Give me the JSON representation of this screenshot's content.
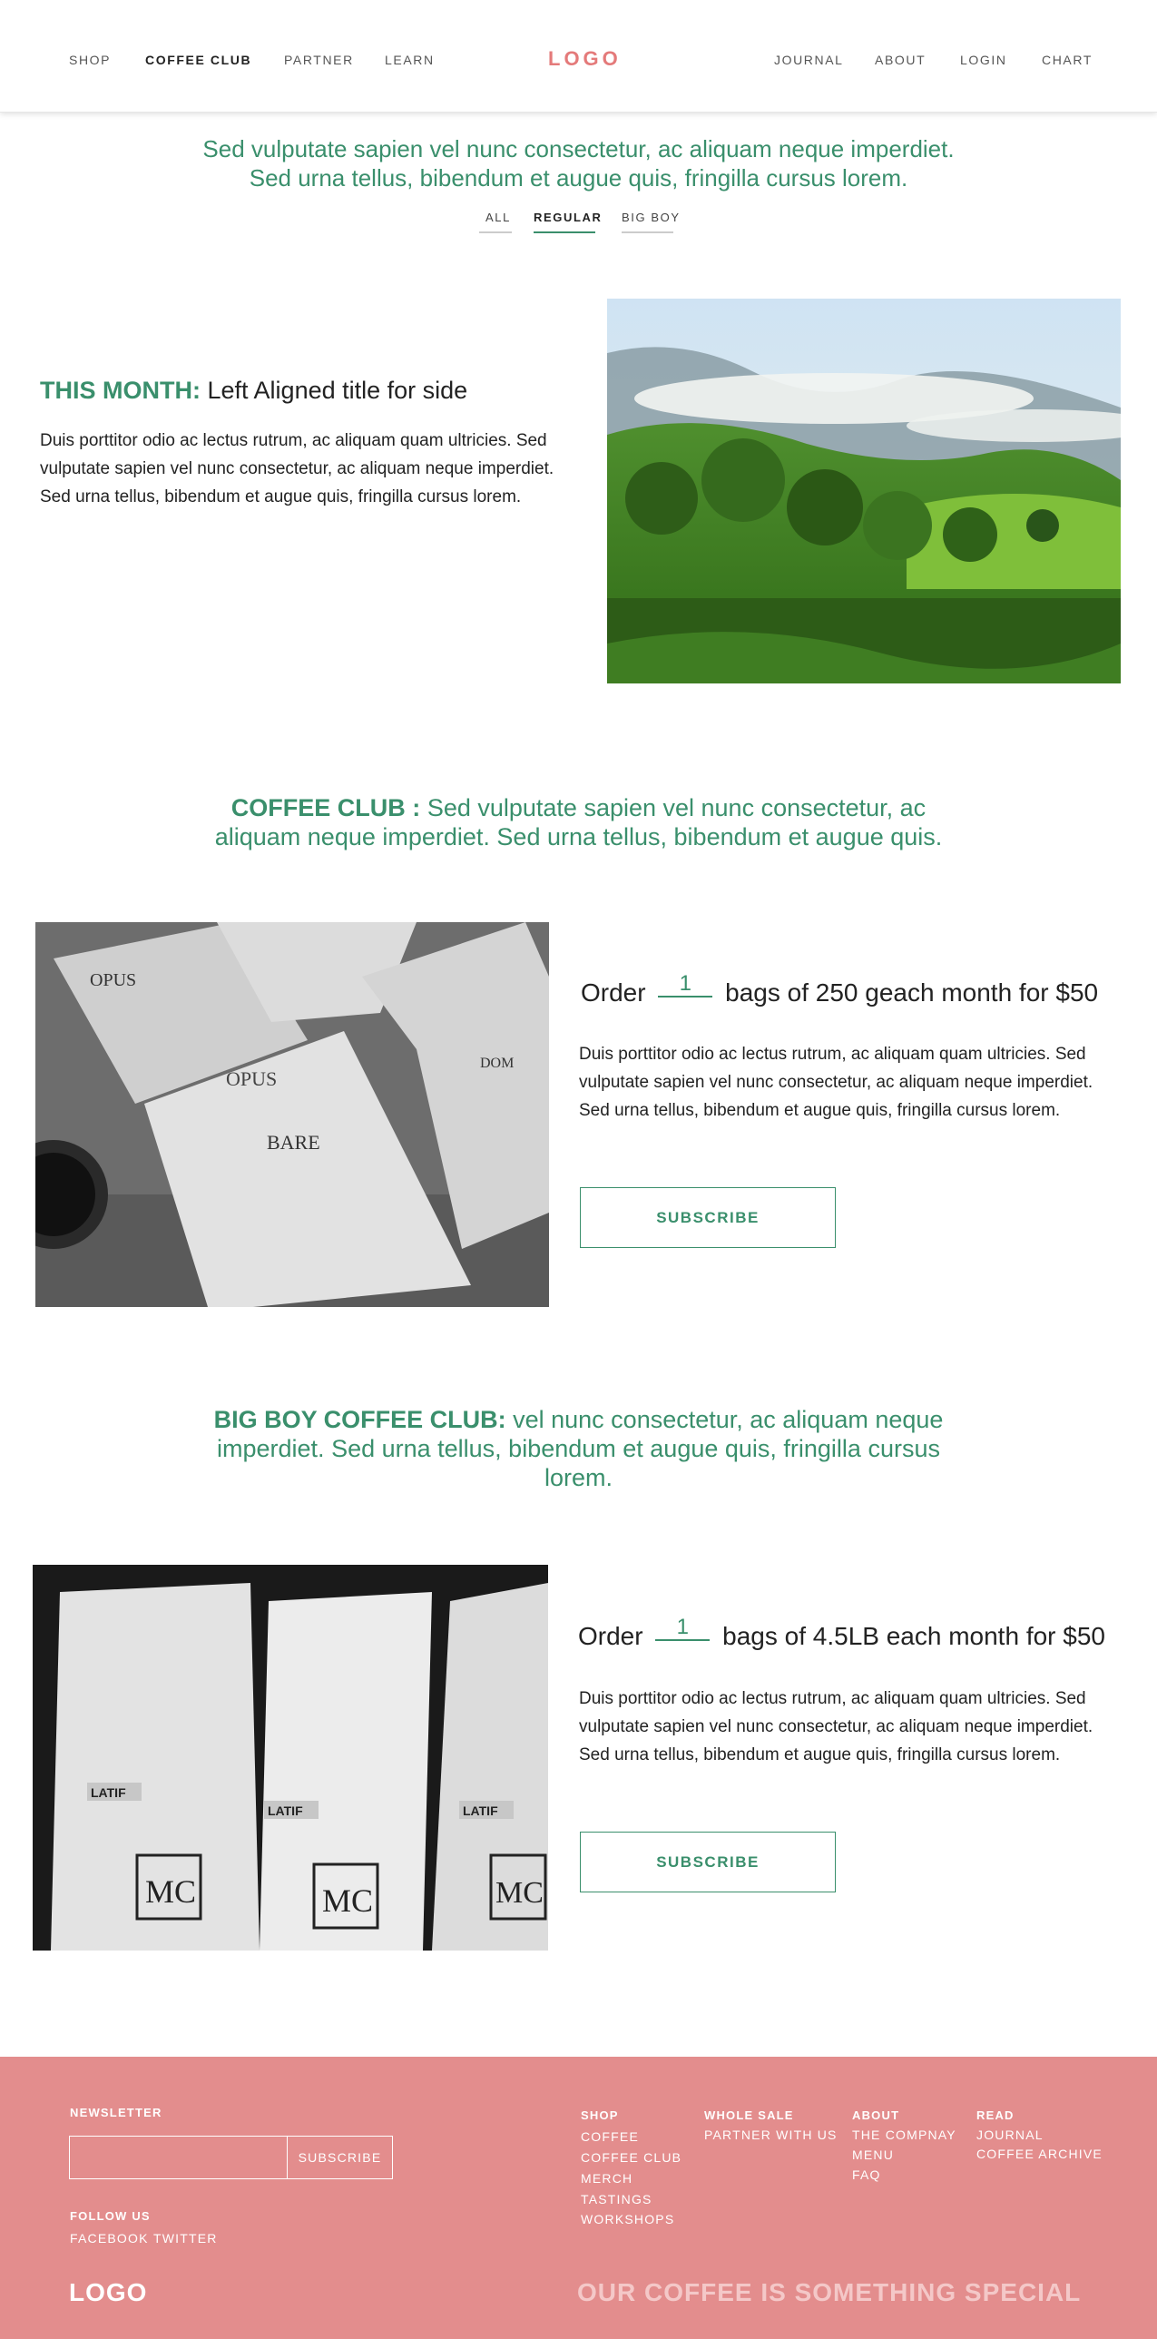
{
  "header": {
    "nav_left": [
      "SHOP",
      "COFFEE CLUB",
      "PARTNER",
      "LEARN"
    ],
    "logo": "LOGO",
    "nav_right": [
      "JOURNAL",
      "ABOUT",
      "LOGIN",
      "CHART"
    ],
    "active": "COFFEE CLUB"
  },
  "intro": {
    "line1": "Sed vulputate sapien vel nunc consectetur, ac aliquam neque imperdiet.",
    "line2": "Sed urna tellus, bibendum et augue quis, fringilla cursus lorem.",
    "filters": [
      "ALL",
      "REGULAR",
      "BIG BOY"
    ],
    "active_filter": "REGULAR"
  },
  "this_month": {
    "label": "THIS MONTH:",
    "title": "Left Aligned title for side",
    "body": "Duis porttitor odio ac lectus rutrum, ac aliquam quam ultricies. Sed vulputate sapien vel nunc consectetur, ac aliquam neque imperdiet. Sed urna tellus, bibendum et augue quis, fringilla cursus lorem."
  },
  "coffee_club": {
    "label": "COFFEE CLUB :",
    "heading": "Sed vulputate sapien vel nunc consectetur, ac aliquam neque imperdiet. Sed urna tellus, bibendum et augue quis.",
    "order_prefix": "Order",
    "quantity": "1",
    "order_suffix": "bags of 250 geach month for $50",
    "body": "Duis porttitor odio ac lectus rutrum, ac aliquam quam ultricies. Sed vulputate sapien vel nunc consectetur, ac aliquam neque imperdiet. Sed urna tellus, bibendum et augue quis, fringilla cursus lorem.",
    "button": "SUBSCRIBE"
  },
  "big_boy": {
    "label": "BIG BOY COFFEE CLUB:",
    "heading": "vel nunc consectetur, ac aliquam neque imperdiet. Sed urna tellus, bibendum et augue quis, fringilla cursus lorem.",
    "order_prefix": "Order",
    "quantity": "1",
    "order_suffix": "bags of 4.5LB each month for $50",
    "body": "Duis porttitor odio ac lectus rutrum, ac aliquam quam ultricies. Sed vulputate sapien vel nunc consectetur, ac aliquam neque imperdiet. Sed urna tellus, bibendum et augue quis, fringilla cursus lorem.",
    "button": "SUBSCRIBE"
  },
  "footer": {
    "newsletter": "NEWSLETTER",
    "newsletter_button": "SUBSCRIBE",
    "follow": "FOLLOW US",
    "social": [
      "FACEBOOK",
      "TWITTER"
    ],
    "columns": [
      {
        "title": "SHOP",
        "links": [
          "COFFEE",
          "COFFEE CLUB",
          "MERCH",
          "TASTINGS",
          "WORKSHOPS"
        ]
      },
      {
        "title": "WHOLE SALE",
        "links": [
          "PARTNER WITH US"
        ]
      },
      {
        "title": "ABOUT",
        "links": [
          "THE COMPNAY",
          "MENU",
          "FAQ"
        ]
      },
      {
        "title": "READ",
        "links": [
          "JOURNAL",
          "COFFEE ARCHIVE"
        ]
      }
    ],
    "logo": "LOGO",
    "tagline": "OUR COFFEE IS SOMETHING SPECIAL"
  },
  "colors": {
    "accent_green": "#3a8f6c",
    "logo_pink": "#e47a7a",
    "footer_pink": "#e38d8d"
  }
}
